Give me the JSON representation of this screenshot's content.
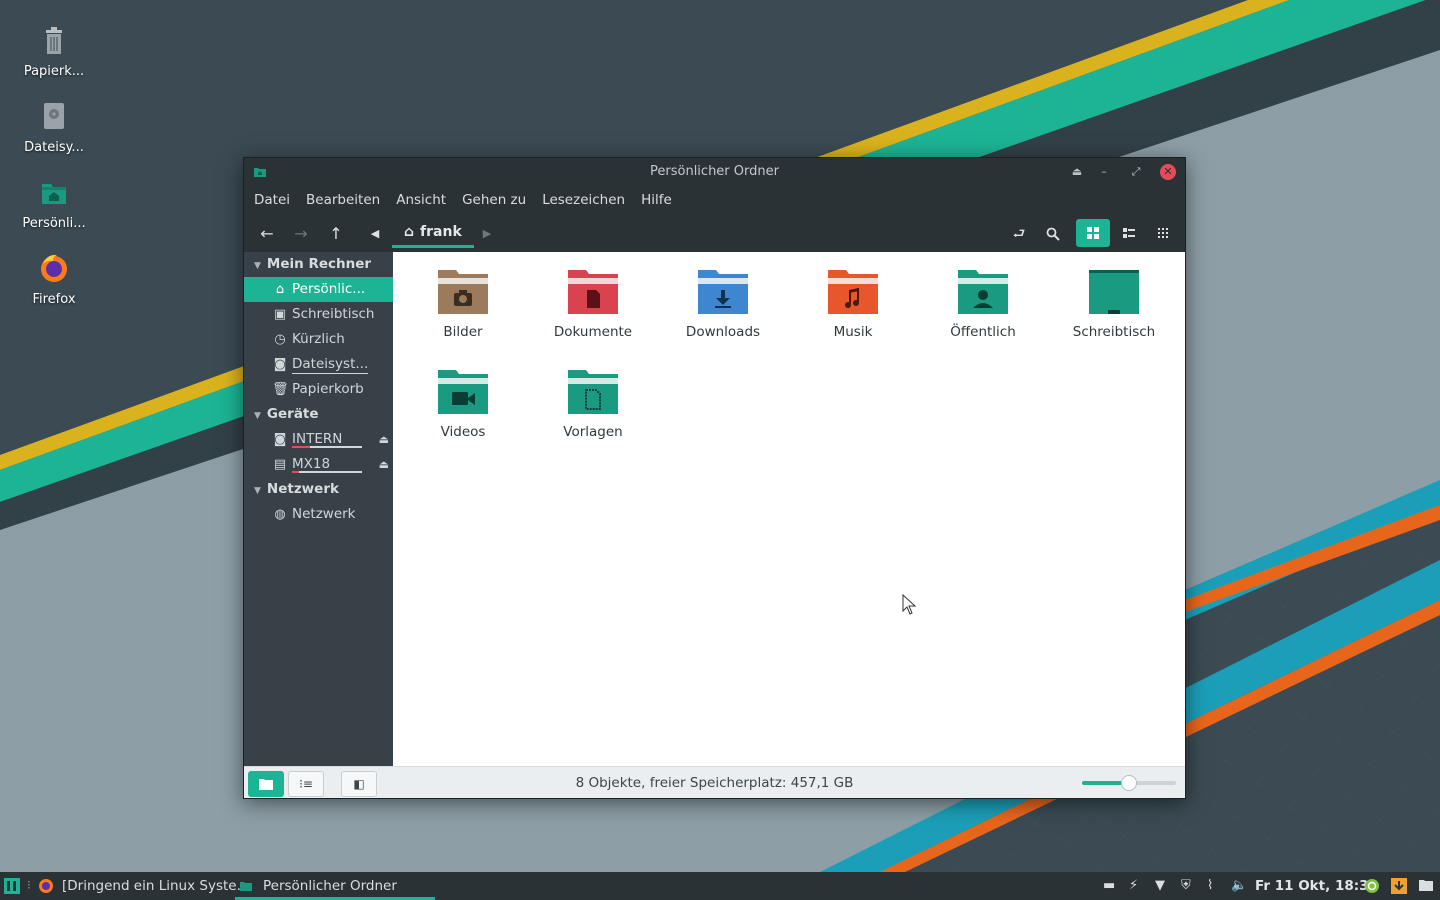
{
  "colors": {
    "accent": "#1db395",
    "window_dark": "#2b3236",
    "sidebar": "#384147",
    "close": "#e54c5a",
    "wall_yellow": "#d9b21d",
    "wall_teal": "#1db395",
    "wall_orange": "#e8661c",
    "wall_cyan": "#1b9fb8"
  },
  "desktop": {
    "icons": [
      {
        "label": "Papierk...",
        "icon": "trash-icon"
      },
      {
        "label": "Dateisy...",
        "icon": "drive-icon"
      },
      {
        "label": "Persönli...",
        "icon": "home-folder-icon"
      },
      {
        "label": "Firefox",
        "icon": "firefox-icon"
      }
    ]
  },
  "window": {
    "title": "Persönlicher Ordner",
    "menu": [
      "Datei",
      "Bearbeiten",
      "Ansicht",
      "Gehen zu",
      "Lesezeichen",
      "Hilfe"
    ],
    "breadcrumb": "frank",
    "sidebar": {
      "sections": [
        {
          "title": "Mein Rechner",
          "items": [
            {
              "label": "Persönlic...",
              "icon": "home-icon",
              "active": true
            },
            {
              "label": "Schreibtisch",
              "icon": "desktop-icon"
            },
            {
              "label": "Kürzlich",
              "icon": "clock-icon"
            },
            {
              "label": "Dateisyst...",
              "icon": "drive-icon"
            },
            {
              "label": "Papierkorb",
              "icon": "trash-icon"
            }
          ]
        },
        {
          "title": "Geräte",
          "items": [
            {
              "label": "INTERN",
              "icon": "drive-icon",
              "eject": true,
              "usage": 0.25
            },
            {
              "label": "MX18",
              "icon": "usb-drive-icon",
              "eject": true,
              "usage": 0.1
            }
          ]
        },
        {
          "title": "Netzwerk",
          "items": [
            {
              "label": "Netzwerk",
              "icon": "network-icon"
            }
          ]
        }
      ]
    },
    "files": [
      {
        "name": "Bilder",
        "color": "#9c7a5c",
        "emblem": "camera"
      },
      {
        "name": "Dokumente",
        "color": "#d9424f",
        "emblem": "document"
      },
      {
        "name": "Downloads",
        "color": "#3f86d0",
        "emblem": "download"
      },
      {
        "name": "Musik",
        "color": "#e8562c",
        "emblem": "music"
      },
      {
        "name": "Öffentlich",
        "color": "#1a9a80",
        "emblem": "person"
      },
      {
        "name": "Schreibtisch",
        "color": "#1a9a80",
        "emblem": "desktop"
      },
      {
        "name": "Videos",
        "color": "#1a9a80",
        "emblem": "video"
      },
      {
        "name": "Vorlagen",
        "color": "#1a9a80",
        "emblem": "template"
      }
    ],
    "status": "8 Objekte, freier Speicherplatz: 457,1 GB",
    "zoom_level": 0.5
  },
  "panel": {
    "tasks": [
      {
        "label": "[Dringend ein Linux Syste...",
        "icon": "firefox-icon"
      },
      {
        "label": "Persönlicher Ordner",
        "icon": "folder-icon",
        "active": true
      }
    ],
    "clock": "Fr 11 Okt, 18:32"
  }
}
